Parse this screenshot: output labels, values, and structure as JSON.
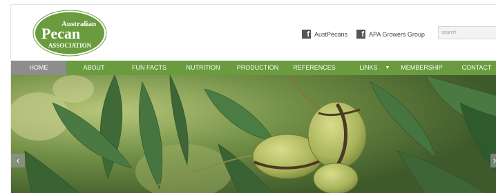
{
  "logo": {
    "line1": "Australian",
    "line2": "Pecan",
    "line3": "ASSOCIATION",
    "color": "#6a9b3e"
  },
  "social": [
    {
      "icon": "facebook-icon",
      "glyph": "f",
      "label": "AustPecans"
    },
    {
      "icon": "facebook-icon",
      "glyph": "f",
      "label": "APA Growers Group"
    }
  ],
  "search": {
    "placeholder": "search",
    "value": ""
  },
  "nav": {
    "home": "HOME",
    "about": "ABOUT",
    "fun_facts": "FUN FACTS",
    "nutrition": "NUTRITION",
    "production": "PRODUCTION",
    "references": "REFERENCES",
    "links": "LINKS",
    "links_caret": "▼",
    "membership": "MEMBERSHIP",
    "contact": "CONTACT",
    "active": "HOME",
    "bar_color": "#6a9b3e",
    "active_color": "#8d8d8d"
  },
  "hero": {
    "arrow_left": "‹",
    "arrow_right": "›"
  }
}
